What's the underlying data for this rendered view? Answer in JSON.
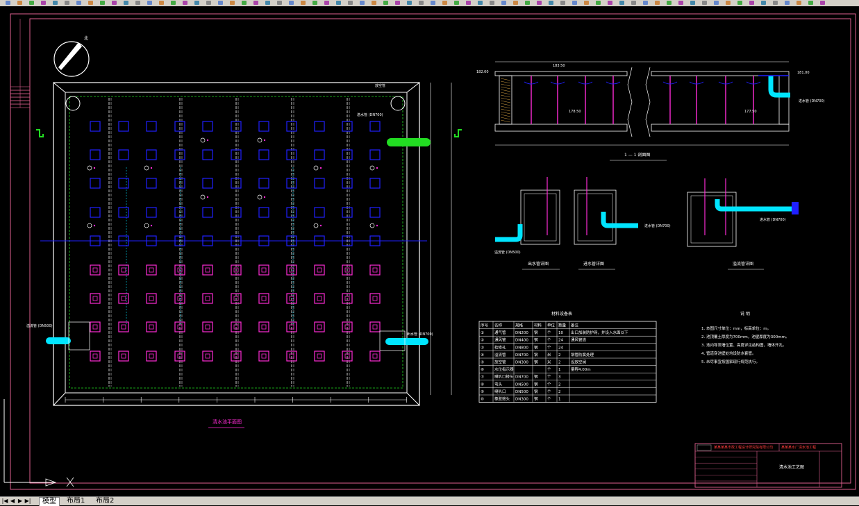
{
  "colors": {
    "background": "#000000",
    "frame": "#e06090",
    "wall": "#ffffff",
    "cyan": "#00e5ff",
    "green": "#22dd22",
    "magenta": "#ff2bd6",
    "blue": "#2020ff",
    "dim": "#9a9a9a",
    "title_red": "#ff3b3b"
  },
  "drawing": {
    "plan_title": "清水池平面图",
    "section_title": "1 — 1 剖面图",
    "outlet_title": "出水管详图",
    "inlet_title": "进水管详图",
    "overflow_title": "溢流管详图",
    "north_label": "北",
    "pipes": {
      "inlet": "进水管 (DN700)",
      "overflow": "溢流管 (DN500)",
      "outlet": "出水管 (DN700)",
      "drain": "放空管"
    },
    "elevations": [
      "182.00",
      "178.50",
      "183.50",
      "181.00",
      "177.50"
    ]
  },
  "material_table": {
    "title": "材料设备表",
    "headers": [
      "序号",
      "名称",
      "规格",
      "材料",
      "单位",
      "数量",
      "备注"
    ],
    "rows": [
      [
        "①",
        "通气管",
        "DN200",
        "钢",
        "个",
        "10",
        "出口加装防护网，并设入水面以下"
      ],
      [
        "②",
        "通风管",
        "DN400",
        "钢",
        "个",
        "24",
        "通风管道"
      ],
      [
        "③",
        "检修孔",
        "DN800",
        "钢",
        "个",
        "24",
        ""
      ],
      [
        "④",
        "溢流管",
        "DN700",
        "钢",
        "米",
        "2",
        "钢管防腐处理"
      ],
      [
        "⑤",
        "放空管",
        "DN300",
        "钢",
        "米",
        "2",
        "设放空阀"
      ],
      [
        "⑥",
        "水位指示器",
        "",
        "",
        "个",
        "1",
        "量程4.00m"
      ],
      [
        "⑦",
        "喇叭口接头",
        "DN700",
        "钢",
        "个",
        "3",
        ""
      ],
      [
        "⑧",
        "弯头",
        "DN500",
        "钢",
        "个",
        "2",
        ""
      ],
      [
        "⑨",
        "喇叭口",
        "DN500",
        "钢",
        "个",
        "2",
        ""
      ],
      [
        "⑩",
        "橡胶接头",
        "DN300",
        "钢",
        "个",
        "1",
        ""
      ]
    ]
  },
  "notes": {
    "title": "说 明",
    "items": [
      "1. 本图尺寸单位：mm，标高单位：m。",
      "2. 池顶覆土厚度为700mm，池壁厚度为300mm。",
      "3. 池内导流墙位置、高度详见结构图，墙体开孔。",
      "4. 管道穿池壁处均设防水套管。",
      "5. 未尽事宜按国家现行规范执行。"
    ]
  },
  "title_block": {
    "company": "某某某某市政工程设计研究院有限公司",
    "project": "某某某水厂清水池工程",
    "drawing_name": "清水池工艺图"
  },
  "tabs": [
    {
      "label": "模型",
      "active": true
    },
    {
      "label": "布局1",
      "active": false
    },
    {
      "label": "布局2",
      "active": false
    }
  ],
  "nav": {
    "first": "|◀",
    "prev": "◀",
    "next": "▶",
    "last": "▶|"
  }
}
